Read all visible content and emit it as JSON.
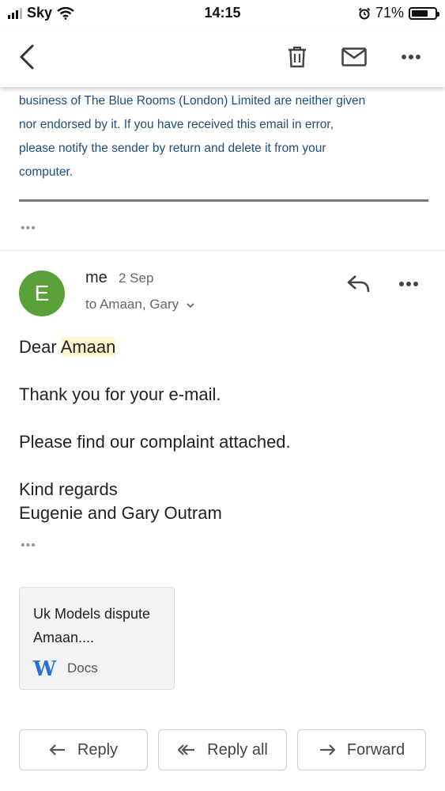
{
  "status_bar": {
    "carrier": "Sky",
    "time": "14:15",
    "battery": "71%",
    "battery_fraction": 0.71
  },
  "toolbar": {
    "back": "back-icon",
    "delete": "trash-icon",
    "mark_unread": "mail-icon",
    "more": "more-icon"
  },
  "disclaimer": [
    "business of The Blue Rooms (London) Limited are neither given",
    "nor endorsed by it. If you have received this email in error,",
    "please notify the sender by return and delete it from your",
    "computer."
  ],
  "trimmed_dots": "•••",
  "message": {
    "avatar_letter": "E",
    "sender": "me",
    "date": "2 Sep",
    "recipients": "to Amaan, Gary",
    "greeting_prefix": "Dear ",
    "greeting_name": "Amaan",
    "line1": "Thank you for your e-mail.",
    "line2": "Please find our complaint attached.",
    "signoff": "Kind regards",
    "signature": "Eugenie and Gary Outram",
    "trimmed": "•••"
  },
  "attachment": {
    "name": "Uk Models dispute Amaan....",
    "icon_letter": "W",
    "type": "Docs"
  },
  "actions": {
    "reply": "Reply",
    "reply_all": "Reply all",
    "forward": "Forward"
  },
  "colors": {
    "avatar": "#5aa13a",
    "disclaimer_text": "#1f4e79",
    "highlight": "#fdf6d1",
    "word_icon": "#2b6fd6"
  }
}
